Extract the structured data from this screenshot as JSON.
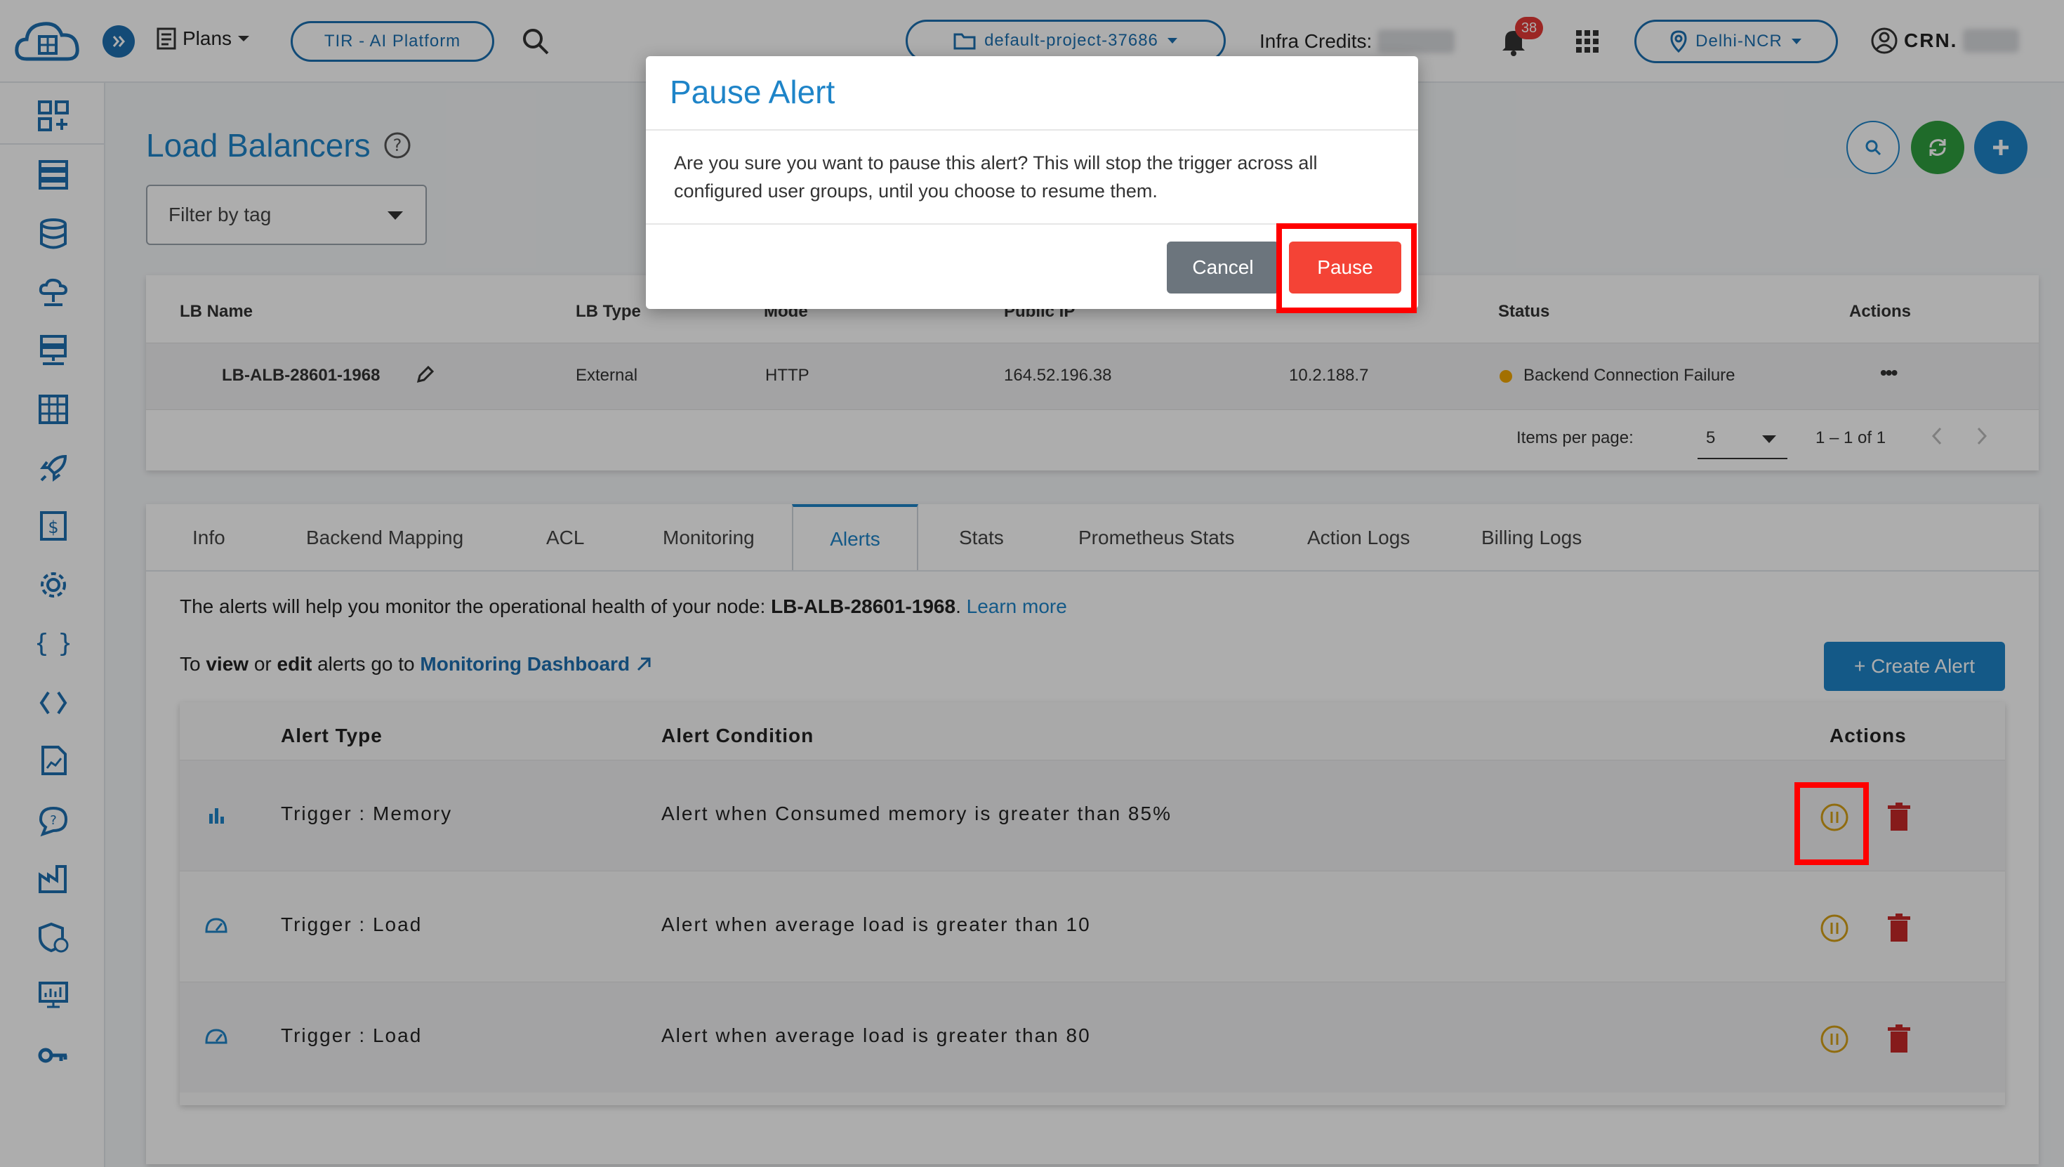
{
  "topbar": {
    "plans_label": "Plans",
    "platform_label": "TIR - AI Platform",
    "project_label": "default-project-37686",
    "infra_credits_label": "Infra Credits:",
    "notification_count": "38",
    "region_label": "Delhi-NCR",
    "account_label": "CRN."
  },
  "page": {
    "title": "Load Balancers",
    "filter_placeholder": "Filter by tag"
  },
  "lb_table": {
    "headers": [
      "LB Name",
      "LB Type",
      "Mode",
      "Public IP",
      "Status",
      "Actions"
    ],
    "row": {
      "name": "LB-ALB-28601-1968",
      "type": "External",
      "mode": "HTTP",
      "public_ip": "164.52.196.38",
      "private_ip": "10.2.188.7",
      "status": "Backend Connection Failure",
      "actions": "•••"
    },
    "items_per_page_label": "Items per page:",
    "items_per_page": "5",
    "pagination": "1 – 1 of 1"
  },
  "tabs": [
    "Info",
    "Backend Mapping",
    "ACL",
    "Monitoring",
    "Alerts",
    "Stats",
    "Prometheus Stats",
    "Action Logs",
    "Billing Logs"
  ],
  "alerts": {
    "intro_prefix": "The alerts will help you monitor the operational health of your node: ",
    "node_name": "LB-ALB-28601-1968",
    "intro_suffix": ".",
    "learn_more": "Learn more",
    "to": "To ",
    "view": "view",
    "or": " or ",
    "edit": "edit",
    "goto": " alerts go to ",
    "dashboard_link": "Monitoring Dashboard",
    "create_button": "+ Create Alert",
    "headers": {
      "type": "Alert Type",
      "condition": "Alert Condition",
      "actions": "Actions"
    },
    "rows": [
      {
        "type": "Trigger : Memory",
        "condition": "Alert when Consumed memory is greater than 85%",
        "icon": "bar-chart-icon"
      },
      {
        "type": "Trigger : Load",
        "condition": "Alert when average load is greater than 10",
        "icon": "gauge-icon"
      },
      {
        "type": "Trigger : Load",
        "condition": "Alert when average load is greater than 80",
        "icon": "gauge-icon"
      }
    ]
  },
  "dialog": {
    "title": "Pause Alert",
    "message": "Are you sure you want to pause this alert? This will stop the trigger across all configured user groups, until you choose to resume them.",
    "cancel": "Cancel",
    "confirm": "Pause"
  },
  "colors": {
    "accent": "#1e84c8",
    "pause_button": "#f44336",
    "cancel_button": "#6c757d",
    "highlight": "#ff0000",
    "status_dot": "#f0a500",
    "delete_icon": "#c62828"
  }
}
